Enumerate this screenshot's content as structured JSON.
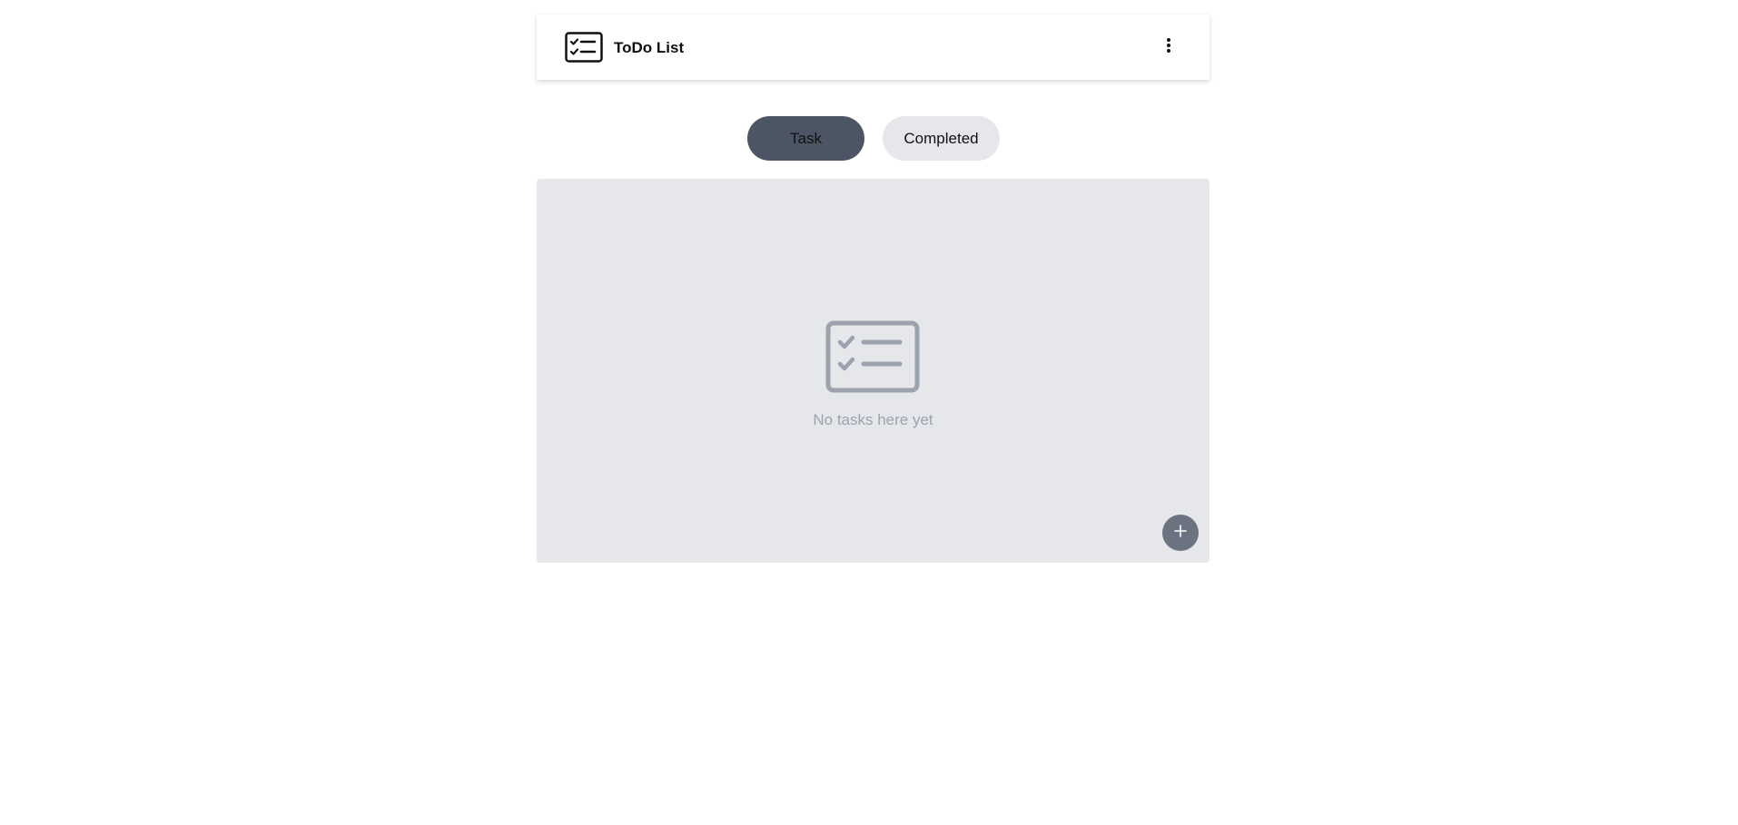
{
  "header": {
    "title": "ToDo List",
    "logo_icon": "checklist-icon",
    "menu_icon": "more-vertical-icon"
  },
  "tabs": [
    {
      "label": "Task",
      "active": true
    },
    {
      "label": "Completed",
      "active": false
    }
  ],
  "empty_state": {
    "icon": "checklist-icon",
    "message": "No tasks here yet"
  },
  "fab": {
    "icon": "plus-icon"
  },
  "colors": {
    "active_tab": "#4b5563",
    "inactive_tab": "#e5e7eb",
    "panel_bg": "#e5e7eb",
    "muted_text": "#9ca3af",
    "fab_bg": "#6b7280"
  }
}
